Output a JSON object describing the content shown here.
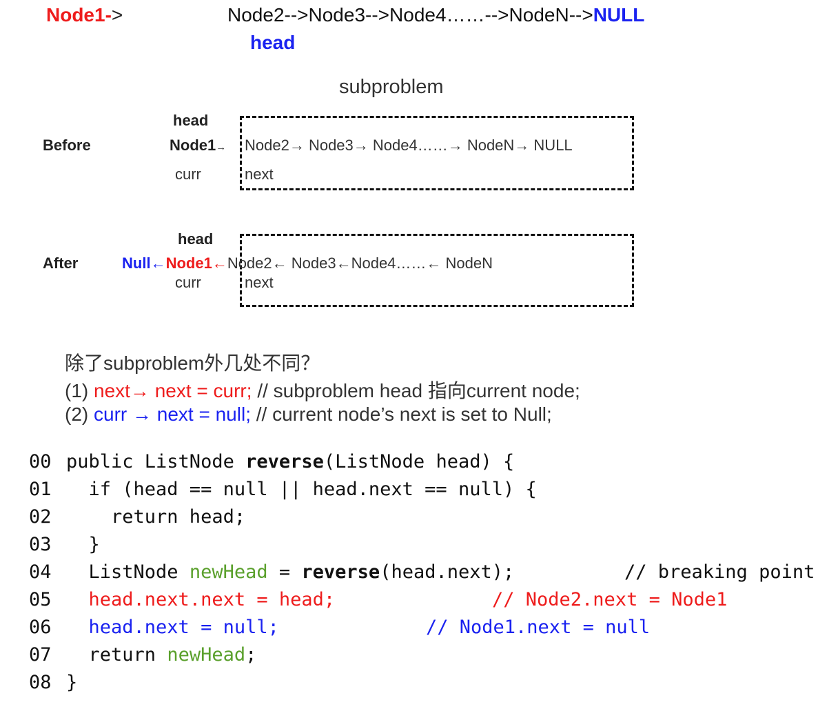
{
  "header": {
    "node1": "Node1-",
    "node1_arrow": ">",
    "chain": "Node2-->Node3-->Node4……-->NodeN-->",
    "null_label": "NULL",
    "head_label": "head"
  },
  "diagram": {
    "title": "subproblem",
    "before": {
      "row_label": "Before",
      "head": "head",
      "node1": "Node1",
      "arrow1": "→",
      "chain": "Node2→ Node3→ Node4……→ NodeN→ NULL",
      "curr": "curr",
      "next": "next"
    },
    "after": {
      "row_label": "After",
      "head": "head",
      "null_part": "Null←",
      "node1_part": "Node1←",
      "chain": "Node2← Node3←Node4……← NodeN",
      "curr": "curr",
      "next": "next"
    }
  },
  "question": {
    "title": "除了subproblem外几处不同？",
    "line1_prefix": "(1) ",
    "line1_code": "next→ next = curr;",
    "line1_comment": " // subproblem head 指向current node;",
    "line2_prefix": "(2) ",
    "line2_code": "curr → next = null;",
    "line2_comment": " // current node’s next is set to Null;"
  },
  "code": {
    "line_numbers": [
      "00",
      "01",
      "02",
      "03",
      "04",
      "05",
      "06",
      "07",
      "08"
    ],
    "l0_pre": "public ListNode ",
    "l0_fn": "reverse",
    "l0_post": "(ListNode head) {",
    "l1": "  if (head == null || head.next == null) {",
    "l2": "    return head;",
    "l3": "  }",
    "l4_pre": "  ListNode ",
    "l4_var": "newHead",
    "l4_mid": " = ",
    "l4_fn": "reverse",
    "l4_post": "(head.next);",
    "l4_comment": "// breaking point",
    "l5": "  head.next.next = head;",
    "l5_comment": "// Node2.next = Node1",
    "l6": "  head.next = null;",
    "l6_comment": "// Node1.next = null",
    "l7_pre": "  return ",
    "l7_var": "newHead",
    "l7_post": ";",
    "l8": "}"
  },
  "colors": {
    "red": "#ee1c1c",
    "blue": "#1a22f0",
    "green": "#5aa02c"
  }
}
